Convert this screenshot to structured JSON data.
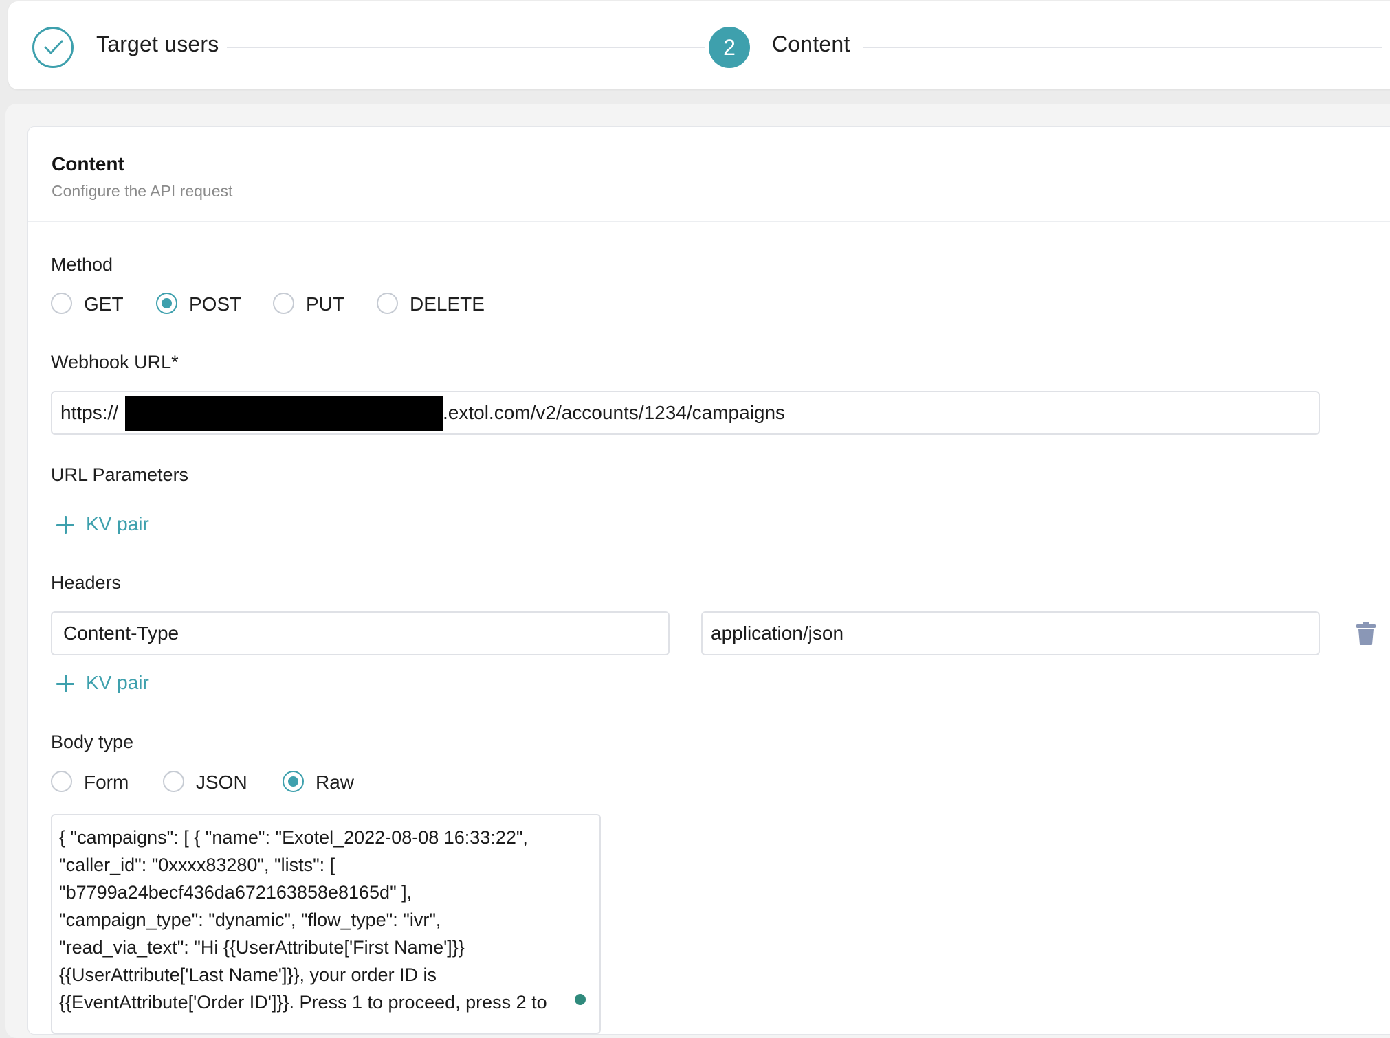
{
  "stepper": {
    "step1": {
      "label": "Target users",
      "status": "done"
    },
    "step2": {
      "number": "2",
      "label": "Content",
      "status": "active"
    }
  },
  "content_section": {
    "title": "Content",
    "subtitle": "Configure the API request"
  },
  "method": {
    "label": "Method",
    "options": [
      "GET",
      "POST",
      "PUT",
      "DELETE"
    ],
    "selected": "POST"
  },
  "webhook_url": {
    "label": "Webhook URL*",
    "value_prefix": "https://",
    "value_suffix": ".extol.com/v2/accounts/1234/campaigns"
  },
  "url_parameters": {
    "label": "URL Parameters",
    "add_label": "KV pair"
  },
  "headers": {
    "label": "Headers",
    "rows": [
      {
        "key": "Content-Type",
        "value": "application/json"
      }
    ],
    "add_label": "KV pair"
  },
  "body_type": {
    "label": "Body type",
    "options": [
      "Form",
      "JSON",
      "Raw"
    ],
    "selected": "Raw"
  },
  "body": {
    "lines": [
      "{ \"campaigns\": [ { \"name\": \"Exotel_2022-08-08 16:33:22\",",
      "\"caller_id\": \"0xxxx83280\", \"lists\": [",
      "\"b7799a24becf436da672163858e8165d\" ],",
      "\"campaign_type\": \"dynamic\", \"flow_type\": \"ivr\",",
      "\"read_via_text\": \"Hi {{UserAttribute['First Name']}}",
      "{{UserAttribute['Last Name']}}, your order ID is",
      "{{EventAttribute['Order ID']}}. Press 1 to proceed, press 2 to"
    ]
  },
  "colors": {
    "accent": "#3ea0ad",
    "border": "#dfe1e6",
    "muted_text": "#8a8a8a"
  }
}
